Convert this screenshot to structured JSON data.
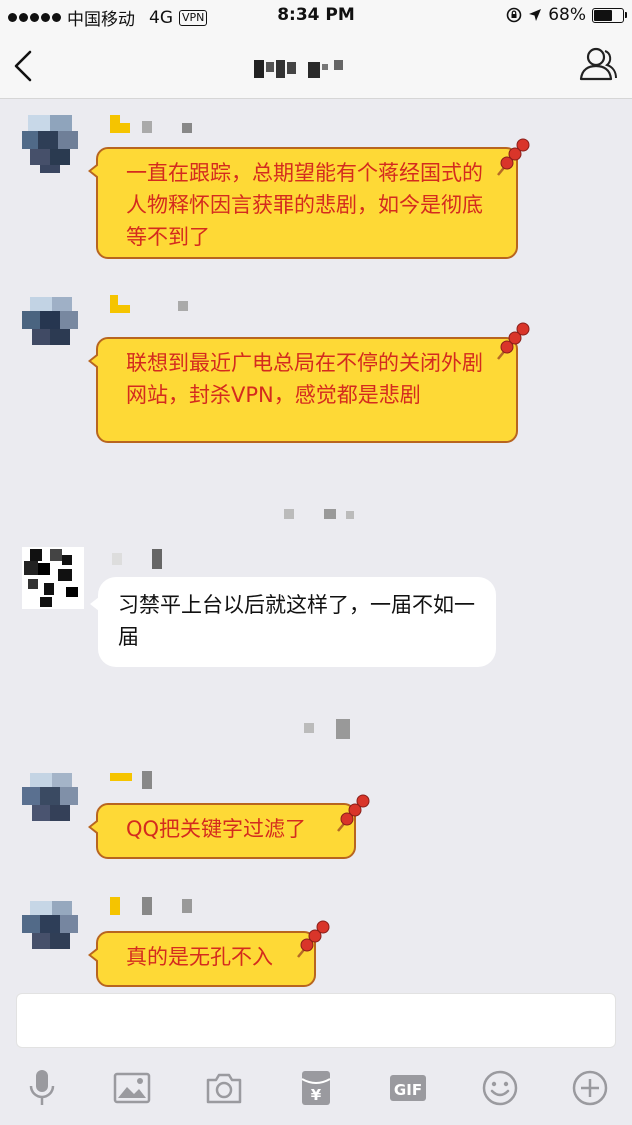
{
  "status_bar": {
    "carrier": "中国移动",
    "network": "4G",
    "vpn": "VPN",
    "time": "8:34 PM",
    "battery_text": "68%",
    "battery_level": 0.68
  },
  "nav": {
    "back_icon": "chevron-left-icon",
    "profile_icon": "person-icon"
  },
  "messages": [
    {
      "style": "yellow",
      "text": "一直在跟踪，总期望能有个蒋经国式的人物释怀因言获罪的悲剧，如今是彻底等不到了"
    },
    {
      "style": "yellow",
      "text": "联想到最近广电总局在不停的关闭外剧网站，封杀VPN，感觉都是悲剧"
    },
    {
      "style": "white",
      "text": "习禁平上台以后就这样了，一届不如一届"
    },
    {
      "style": "yellow",
      "text": "QQ把关键字过滤了"
    },
    {
      "style": "yellow",
      "text": "真的是无孔不入"
    }
  ],
  "input": {
    "placeholder": ""
  },
  "toolbar": {
    "items": [
      "mic-icon",
      "image-icon",
      "camera-icon",
      "red-packet-icon",
      "gif-icon",
      "emoji-icon",
      "plus-icon"
    ],
    "gif_label": "GIF",
    "red_packet_symbol": "¥"
  },
  "colors": {
    "yellow_bubble": "#fed936",
    "yellow_text": "#d42b1e",
    "bubble_border": "#b8651f",
    "background": "#ebebf0",
    "icon_gray": "#9a9a9f"
  }
}
